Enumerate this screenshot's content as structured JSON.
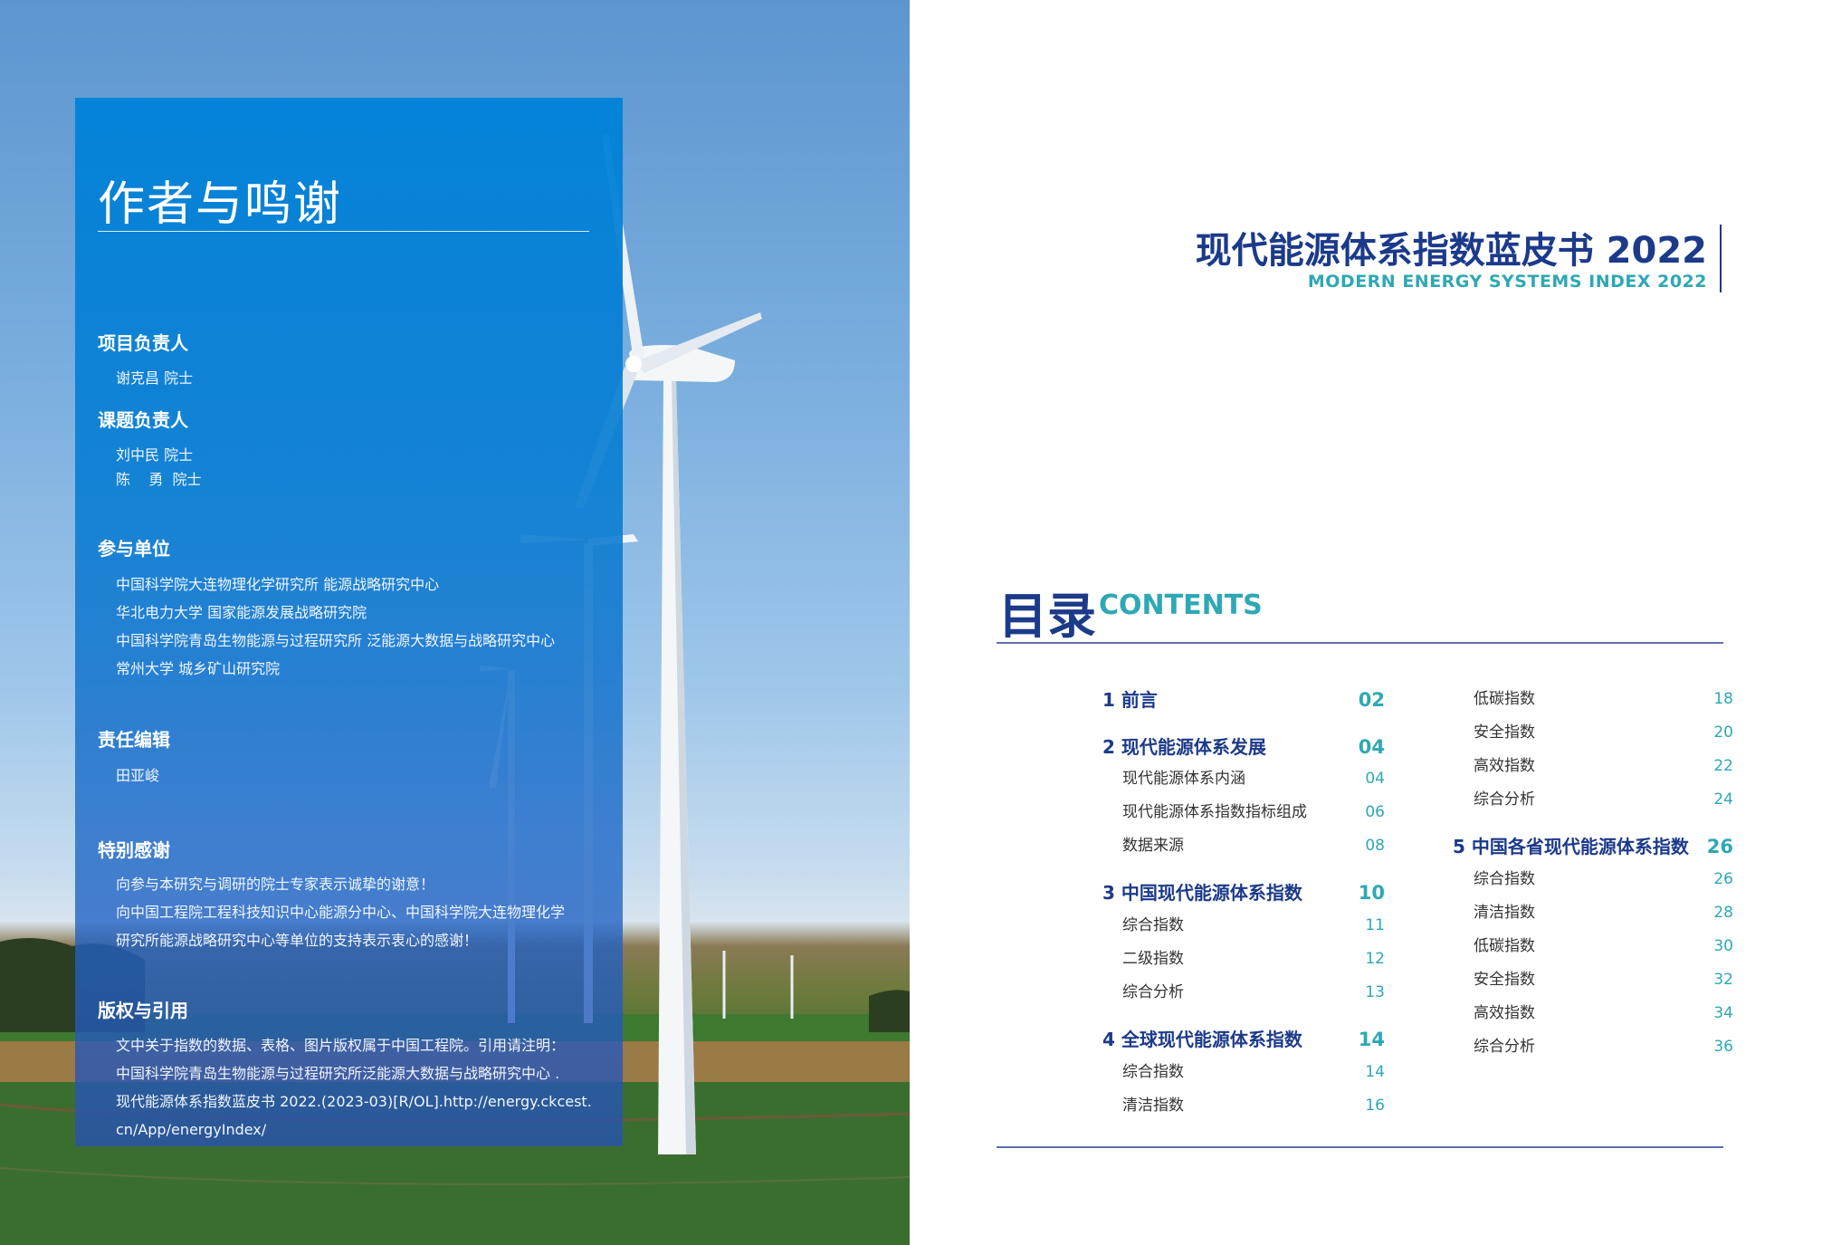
{
  "left": {
    "title": "作者与鸣谢",
    "sections": [
      {
        "heading": "项目负责人",
        "lines": [
          "谢克昌  院士"
        ]
      },
      {
        "heading": "课题负责人",
        "lines": [
          "刘中民  院士",
          "陈    勇  院士"
        ]
      },
      {
        "heading": "参与单位",
        "lines": [
          "中国科学院大连物理化学研究所  能源战略研究中心",
          "华北电力大学  国家能源发展战略研究院",
          "中国科学院青岛生物能源与过程研究所  泛能源大数据与战略研究中心",
          "常州大学  城乡矿山研究院"
        ]
      },
      {
        "heading": "责任编辑",
        "lines": [
          "田亚峻"
        ]
      },
      {
        "heading": "特别感谢",
        "lines": [
          "向参与本研究与调研的院士专家表示诚挚的谢意！",
          "向中国工程院工程科技知识中心能源分中心、中国科学院大连物理化学",
          "研究所能源战略研究中心等单位的支持表示衷心的感谢！"
        ]
      },
      {
        "heading": "版权与引用",
        "lines": [
          "文中关于指数的数据、表格、图片版权属于中国工程院。引用请注明：",
          "中国科学院青岛生物能源与过程研究所泛能源大数据与战略研究中心 .",
          "现代能源体系指数蓝皮书 2022.(2023-03)[R/OL].http://energy.ckcest.",
          "cn/App/energyIndex/"
        ]
      }
    ]
  },
  "right": {
    "book_title": "现代能源体系指数蓝皮书 2022",
    "book_subtitle": "MODERN ENERGY SYSTEMS INDEX 2022",
    "toc_heading_cn": "目录",
    "toc_heading_en": "CONTENTS",
    "toc_left": [
      {
        "label": "1 前言",
        "page": "02",
        "level": "main"
      },
      {
        "label": "2 现代能源体系发展",
        "page": "04",
        "level": "main"
      },
      {
        "label": "现代能源体系内涵",
        "page": "04",
        "level": "sub"
      },
      {
        "label": "现代能源体系指数指标组成",
        "page": "06",
        "level": "sub"
      },
      {
        "label": "数据来源",
        "page": "08",
        "level": "sub"
      },
      {
        "label": "3 中国现代能源体系指数",
        "page": "10",
        "level": "main"
      },
      {
        "label": "综合指数",
        "page": "11",
        "level": "sub"
      },
      {
        "label": "二级指数",
        "page": "12",
        "level": "sub"
      },
      {
        "label": "综合分析",
        "page": "13",
        "level": "sub"
      },
      {
        "label": "4 全球现代能源体系指数",
        "page": "14",
        "level": "main"
      },
      {
        "label": "综合指数",
        "page": "14",
        "level": "sub"
      },
      {
        "label": "清洁指数",
        "page": "16",
        "level": "sub"
      }
    ],
    "toc_right": [
      {
        "label": "低碳指数",
        "page": "18",
        "level": "sub"
      },
      {
        "label": "安全指数",
        "page": "20",
        "level": "sub"
      },
      {
        "label": "高效指数",
        "page": "22",
        "level": "sub"
      },
      {
        "label": "综合分析",
        "page": "24",
        "level": "sub"
      },
      {
        "label": "5 中国各省现代能源体系指数",
        "page": "26",
        "level": "main"
      },
      {
        "label": "综合指数",
        "page": "26",
        "level": "sub"
      },
      {
        "label": "清洁指数",
        "page": "28",
        "level": "sub"
      },
      {
        "label": "低碳指数",
        "page": "30",
        "level": "sub"
      },
      {
        "label": "安全指数",
        "page": "32",
        "level": "sub"
      },
      {
        "label": "高效指数",
        "page": "34",
        "level": "sub"
      },
      {
        "label": "综合分析",
        "page": "36",
        "level": "sub"
      }
    ]
  }
}
